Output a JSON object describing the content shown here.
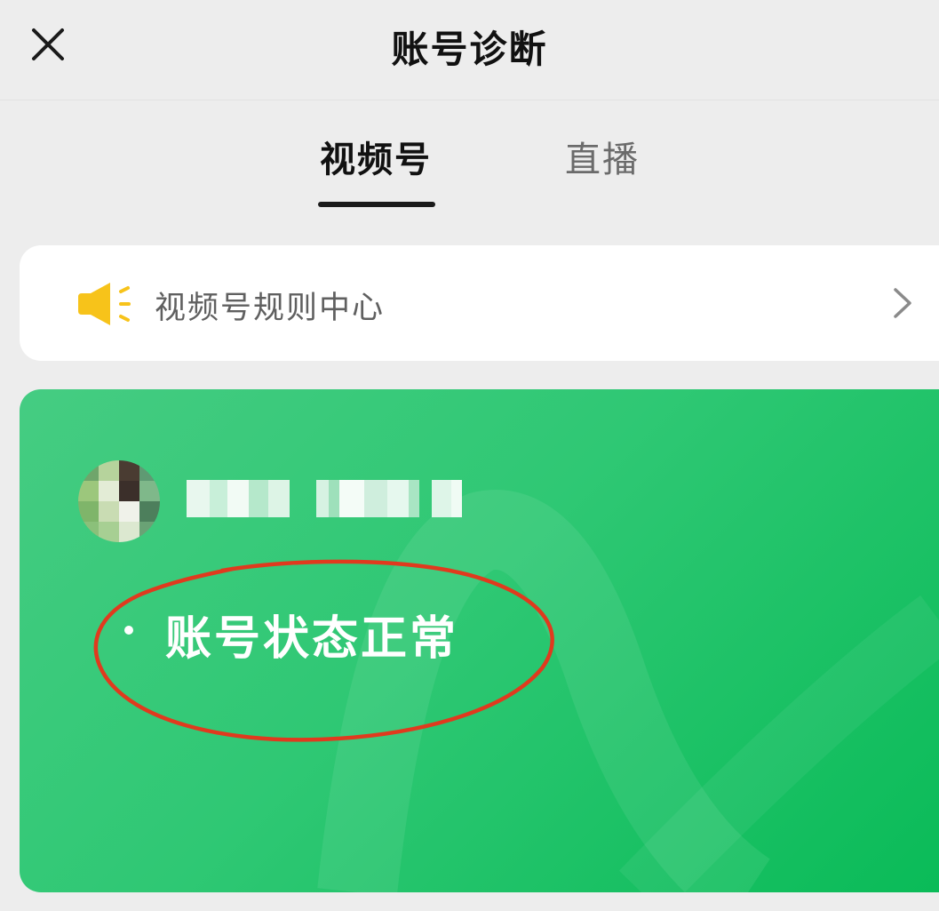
{
  "header": {
    "title": "账号诊断",
    "close_icon": "close-icon"
  },
  "tabs": [
    {
      "label": "视频号",
      "active": true
    },
    {
      "label": "直播",
      "active": false
    }
  ],
  "rule_center": {
    "label": "视频号规则中心",
    "icon": "megaphone-icon",
    "icon_color": "#f7c31a",
    "chevron_icon": "chevron-right-icon"
  },
  "status_card": {
    "status_text": "账号状态正常",
    "bullet": "·",
    "accent_color": "#22c06a"
  },
  "annotation": {
    "shape": "hand-drawn ellipse",
    "color": "#e03a1e"
  }
}
